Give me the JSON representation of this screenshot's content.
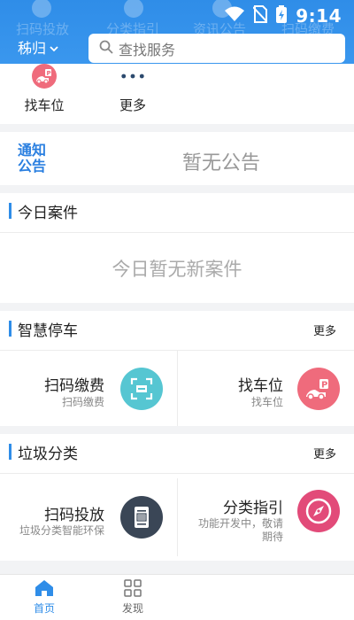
{
  "status_bar": {
    "time": "9:14"
  },
  "header": {
    "city": "秭归",
    "search_placeholder": "查找服务",
    "ghost_labels": [
      "扫码投放",
      "分类指引",
      "资讯公告",
      "扫码缴费"
    ]
  },
  "quick_actions": [
    {
      "label": "找车位",
      "icon": "parking-car-icon"
    },
    {
      "label": "更多",
      "icon": "more-dots-icon"
    }
  ],
  "notice": {
    "tag_line1": "通知",
    "tag_line2": "公告",
    "text": "暂无公告"
  },
  "today_cases": {
    "title": "今日案件",
    "empty_text": "今日暂无新案件"
  },
  "smart_parking": {
    "title": "智慧停车",
    "more": "更多",
    "tiles": [
      {
        "title": "扫码缴费",
        "subtitle": "扫码缴费",
        "icon": "scan-pay-icon"
      },
      {
        "title": "找车位",
        "subtitle": "找车位",
        "icon": "parking-car-icon"
      }
    ]
  },
  "garbage": {
    "title": "垃圾分类",
    "more": "更多",
    "tiles": [
      {
        "title": "扫码投放",
        "subtitle": "垃圾分类智能环保",
        "icon": "scan-bin-icon"
      },
      {
        "title": "分类指引",
        "subtitle_line1": "功能开发中，敬请",
        "subtitle_line2": "期待",
        "icon": "compass-icon"
      }
    ]
  },
  "tabbar": [
    {
      "label": "首页",
      "active": true,
      "icon": "home-icon"
    },
    {
      "label": "发现",
      "active": false,
      "icon": "discover-grid-icon"
    }
  ],
  "colors": {
    "accent": "#2f8de8",
    "parking_red": "#ef6b7c",
    "scan_teal": "#56c6d2",
    "bin_dark": "#3a4656",
    "compass_pink": "#e24b79"
  }
}
